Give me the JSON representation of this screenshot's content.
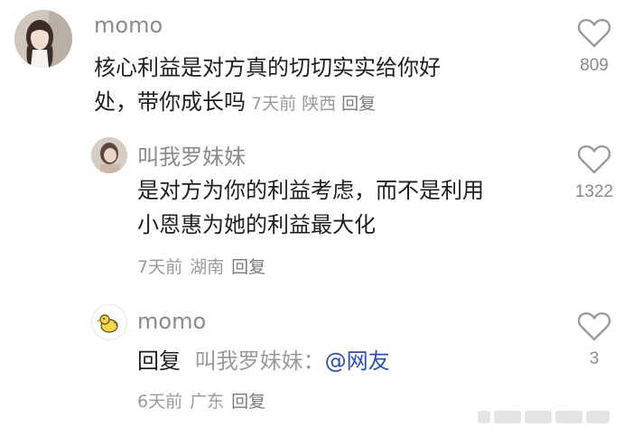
{
  "comments": [
    {
      "username": "momo",
      "content_lines": [
        "核心利益是对方真的切切实实给你好",
        "处，带你成长吗"
      ],
      "time": "7天前",
      "location": "陕西",
      "reply_label": "回复",
      "likes": "809",
      "avatar": "photo-avatar"
    },
    {
      "username": "叫我罗妹妹",
      "content_lines": [
        "是对方为你的利益考虑，而不是利用",
        "小恩惠为她的利益最大化"
      ],
      "time": "7天前",
      "location": "湖南",
      "reply_label": "回复",
      "likes": "1322",
      "avatar": "photo-avatar"
    },
    {
      "username": "momo",
      "reply_prefix": "回复",
      "reply_to": "叫我罗妹妹：",
      "mention": "@网友",
      "time": "6天前",
      "location": "广东",
      "reply_label": "回复",
      "likes": "3",
      "avatar": "duck-avatar"
    }
  ],
  "icons": {
    "like": "heart-outline-icon"
  },
  "colors": {
    "username": "#8a8a8a",
    "text": "#1f1f1f",
    "meta": "#9a9a9a",
    "mention": "#2b4fa8"
  }
}
